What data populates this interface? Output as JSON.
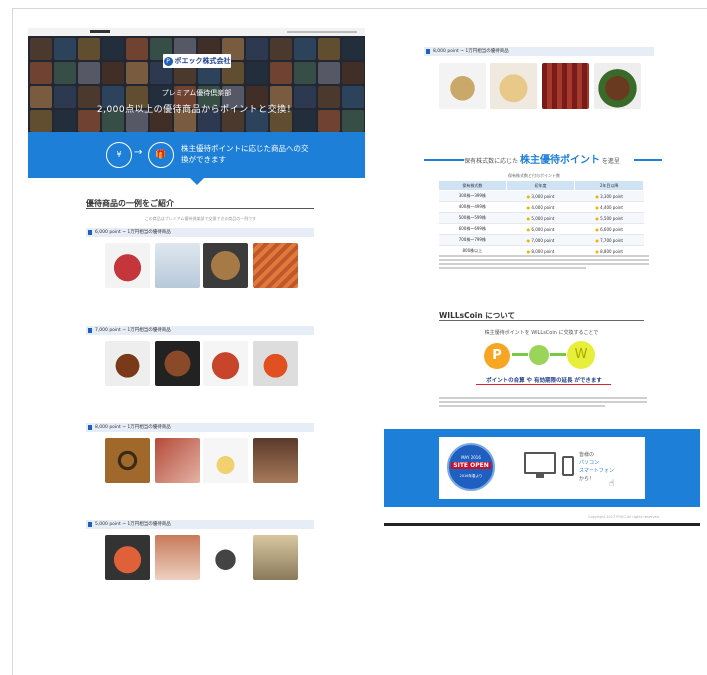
{
  "left_page": {
    "logo": {
      "mark": "P",
      "text": "ポエック株式会社"
    },
    "hero": {
      "subtitle": "プレミアム優待倶楽部",
      "headline": "2,000点以上の優待商品からポイントと交換！"
    },
    "band": {
      "icon1": "¥",
      "icon2": "🎁",
      "text": "株主優待ポイントに応じた商品への交換ができます"
    },
    "section_title": "優待商品の一例をご紹介",
    "section_desc": "この商品はプレミアム優待倶楽部で交換できる商品の一例です",
    "categories": [
      {
        "label": "6,000 point ~ 1万円相当の優待商品",
        "top": 0
      },
      {
        "label": "7,000 point ~ 1万円相当の優待商品",
        "top": 0
      },
      {
        "label": "8,000 point ~ 1万円相当の優待商品",
        "top": 0
      },
      {
        "label": "5,000 point ~ 1万円相当の優待商品",
        "top": 0
      }
    ]
  },
  "right_page": {
    "category_label": "8,000 point ~ 1万円相当の優待商品",
    "points_title_prefix": "保有株式数に応じた",
    "points_title_main": "株主優待ポイント",
    "points_title_suffix": "を進呈",
    "table_caption": "保有株式数と付与ポイント数",
    "table": {
      "headers": [
        "保有株式数",
        "初年度",
        "2年目以降"
      ],
      "rows": [
        [
          "300株〜399株",
          "3,000 point",
          "3,300 point"
        ],
        [
          "400株〜499株",
          "4,000 point",
          "4,400 point"
        ],
        [
          "500株〜599株",
          "5,000 point",
          "5,500 point"
        ],
        [
          "600株〜699株",
          "6,000 point",
          "6,600 point"
        ],
        [
          "700株〜799株",
          "7,000 point",
          "7,700 point"
        ],
        [
          "800株以上",
          "8,000 point",
          "8,800 point"
        ]
      ]
    },
    "willcoin_title": "WILLsCoin について",
    "willcoin_sub": "株主優待ポイントを WILLsCoin に交換することで",
    "willcoin_p": "P",
    "willcoin_w": "W",
    "willcoin_msg": "ポイントの合算 や 有効期限の延長 ができます",
    "banner": {
      "seal_top": "MAY 2016",
      "seal_open": "SITE OPEN",
      "seal_bottom": "2016年春より",
      "text_line1": "皆様の",
      "text_line2": "パソコン",
      "text_line3": "スマートフォン",
      "text_line4": "から！"
    },
    "footer": "Copyright 2017 POEC All rights reserved."
  }
}
